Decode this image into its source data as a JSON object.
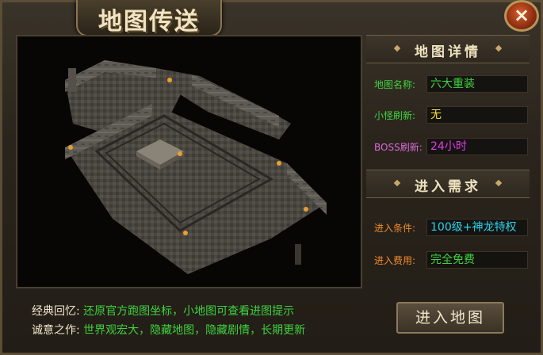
{
  "window": {
    "title": "地图传送",
    "close_symbol": "×",
    "icon_close": "close-icon"
  },
  "map_details": {
    "header": "地图详情",
    "rows": [
      {
        "label": "地图名称:",
        "value": "六大重装",
        "label_color": "#3fd23f",
        "value_color": "#3fd23f"
      },
      {
        "label": "小怪刷新:",
        "value": "无",
        "label_color": "#3fd23f",
        "value_color": "#f0e23a"
      },
      {
        "label": "BOSS刷新:",
        "value": "24小时",
        "label_color": "#d86adb",
        "value_color": "#e23ae8"
      }
    ]
  },
  "requirements": {
    "header": "进入需求",
    "rows": [
      {
        "label": "进入条件:",
        "value": "100级+神龙特权",
        "label_color": "#f08a2a",
        "value_color": "#2ad4ee"
      },
      {
        "label": "进入费用:",
        "value": "完全免费",
        "label_color": "#f08a2a",
        "value_color": "#3fd23f"
      }
    ]
  },
  "info": {
    "line1_label": "经典回忆:",
    "line1_text": "还原官方跑图坐标，小地图可查看进图提示",
    "line2_label": "诚意之作:",
    "line2_text": "世界观宏大，隐藏地图，隐藏剧情，长期更新",
    "label_color": "#f0e6cc",
    "text_color": "#3fd23f"
  },
  "enter_button": {
    "label": "进入地图"
  }
}
